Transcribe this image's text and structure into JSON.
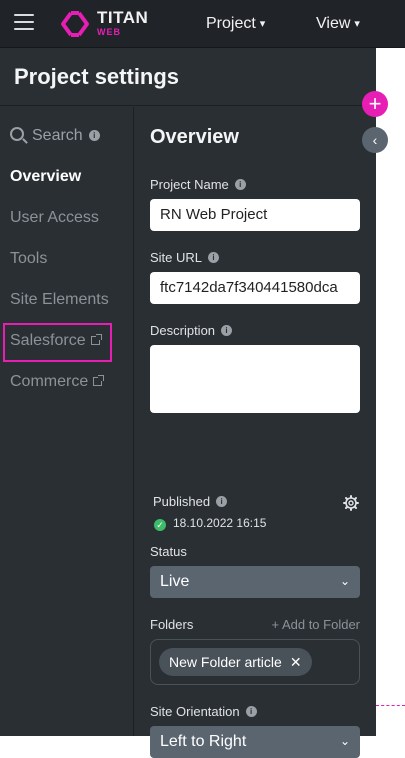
{
  "topbar": {
    "logo_title": "TITAN",
    "logo_sub": "WEB",
    "menus": [
      {
        "label": "Project",
        "caret": "▾"
      },
      {
        "label": "View",
        "caret": "▾"
      }
    ]
  },
  "panel": {
    "title": "Project settings",
    "sidenav": {
      "search_label": "Search",
      "info_glyph": "i",
      "items": [
        {
          "label": "Overview",
          "active": true
        },
        {
          "label": "User Access"
        },
        {
          "label": "Tools"
        },
        {
          "label": "Site Elements"
        },
        {
          "label": "Salesforce",
          "external": true
        },
        {
          "label": "Commerce",
          "external": true
        }
      ]
    },
    "overview": {
      "title": "Overview",
      "project_name_label": "Project Name",
      "project_name_value": "RN Web Project",
      "site_url_label": "Site URL",
      "site_url_value": "ftc7142da7f340441580dca",
      "description_label": "Description",
      "description_value": "",
      "published_label": "Published",
      "published_date": "18.10.2022 16:15",
      "status_label": "Status",
      "status_value": "Live",
      "folders_label": "Folders",
      "add_folder_label": "+ Add to Folder",
      "folder_chips": [
        "New Folder article"
      ],
      "chip_remove_glyph": "✕",
      "orientation_label": "Site Orientation",
      "orientation_value": "Left to Right",
      "select_caret": "⌄"
    }
  },
  "floating": {
    "plus_glyph": "+",
    "collapse_glyph": "‹"
  },
  "colors": {
    "accent": "#e61eb4",
    "panel_bg": "#2a2f34",
    "topbar_bg": "#202429",
    "select_bg": "#5b6570",
    "success": "#3dba6a"
  }
}
